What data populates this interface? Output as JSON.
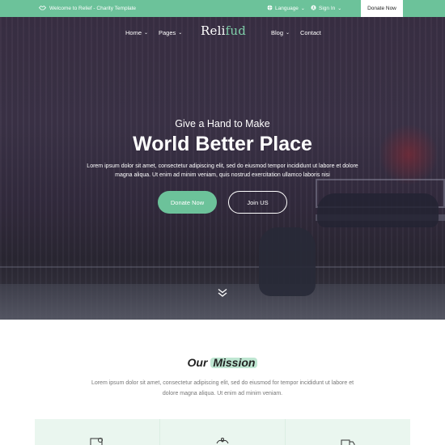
{
  "topbar": {
    "welcome": "Welcome to Relief - Charity Template",
    "language": "Language",
    "sign_in": "Sign In",
    "donate": "Donate Now"
  },
  "nav": {
    "home": "Home",
    "pages": "Pages",
    "blog": "Blog",
    "contact": "Contact",
    "logo_main": "Reli",
    "logo_accent": "fud"
  },
  "hero": {
    "subtitle": "Give a Hand to Make",
    "title": "World Better Place",
    "description": "Lorem ipsum dolor sit amet, consectetur adipiscing elit, sed do eiusmod tempor incididunt ut labore et dolore magna aliqua. Ut enim ad minim veniam, quis nostrud exercitation ullamco laboris nisi",
    "donate_button": "Donate Now",
    "join_button": "Join US"
  },
  "mission": {
    "title_prefix": "Our",
    "title_highlight": "Mission",
    "description": "Lorem ipsum dolor sit amet, consectetur adipiscing elit, sed do eiusmod for tempor incididunt ut labore et dolore magna aliqua. Ut enim ad minim veniam."
  },
  "colors": {
    "accent": "#6cc29a",
    "highlight": "#bfe6d2",
    "card_bg": "#eaf6ef"
  }
}
